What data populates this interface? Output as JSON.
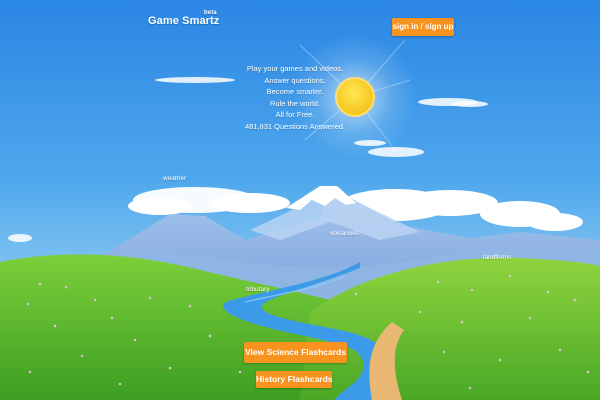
{
  "header": {
    "logo_text": "Game Smartz",
    "logo_badge": "beta",
    "auth_label": "sign in / sign up"
  },
  "tagline": {
    "lines": [
      "Play your games and videos.",
      "Answer questions.",
      "Become smarter.",
      "Rule the world.",
      "All for Free.",
      "481,831 Questions Answered."
    ]
  },
  "hotspots": {
    "weather": "weather",
    "volcanoes": "volcanoes",
    "landforms": "landforms",
    "tributary": "tributary"
  },
  "actions": {
    "science": "View Science Flashcards",
    "history": "History Flashcards"
  },
  "colors": {
    "button": "#f7931e",
    "sky_top": "#2a8ae6",
    "sky_bottom": "#bfe6f7",
    "grass": "#5bbf2f",
    "river": "#3c9be8",
    "path": "#e8b872",
    "sun": "#f9d21c"
  }
}
